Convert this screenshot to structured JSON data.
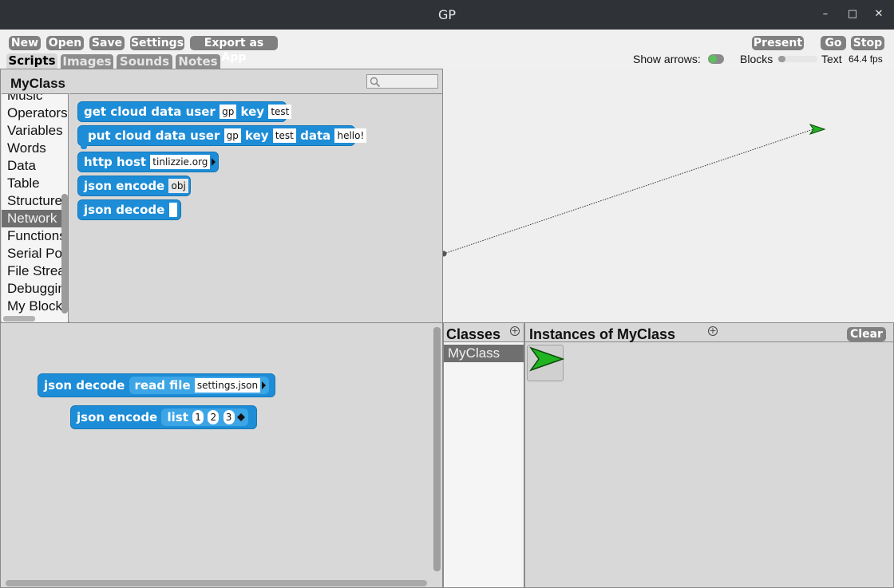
{
  "window": {
    "title": "GP"
  },
  "toolbar": {
    "new": "New",
    "open": "Open",
    "save": "Save",
    "settings": "Settings",
    "export": "Export as App",
    "present": "Present",
    "go": "Go",
    "stop": "Stop"
  },
  "tabs": [
    "Scripts",
    "Images",
    "Sounds",
    "Notes"
  ],
  "status": {
    "show_arrows_label": "Show arrows:",
    "blocks_label": "Blocks",
    "text_label": "Text",
    "fps": "64.4 fps"
  },
  "palette": {
    "class_name": "MyClass",
    "categories": [
      "Music",
      "Operators",
      "Variables",
      "Words",
      "Data",
      "Table",
      "Structure",
      "Network",
      "Functions",
      "Serial Port",
      "File Stream",
      "Debugging",
      "My Blocks"
    ],
    "selected_category": "Network",
    "blocks": {
      "get_cloud": {
        "t1": "get cloud data user",
        "s1": "gp",
        "t2": "key",
        "s2": "test"
      },
      "put_cloud": {
        "t1": "put cloud data user",
        "s1": "gp",
        "t2": "key",
        "s2": "test",
        "t3": "data",
        "s3": "hello!"
      },
      "http_host": {
        "t1": "http host",
        "s1": "tinlizzie.org"
      },
      "json_encode": {
        "t1": "json encode",
        "s1": "obj"
      },
      "json_decode": {
        "t1": "json decode",
        "s1": ""
      }
    }
  },
  "scripts": {
    "decode": {
      "t1": "json decode",
      "t2": "read file",
      "s1": "settings.json"
    },
    "encode": {
      "t1": "json encode",
      "t2": "list",
      "items": [
        "1",
        "2",
        "3"
      ]
    }
  },
  "classes": {
    "title": "Classes",
    "items": [
      "MyClass"
    ]
  },
  "instances": {
    "title": "Instances of MyClass",
    "clear": "Clear"
  },
  "colors": {
    "block_blue": "#1e8dd7",
    "block_inner": "#3ca5e6",
    "toggle_green": "#5cc05c",
    "sprite_green": "#21b421",
    "selected_gray": "#6f6f6f"
  }
}
